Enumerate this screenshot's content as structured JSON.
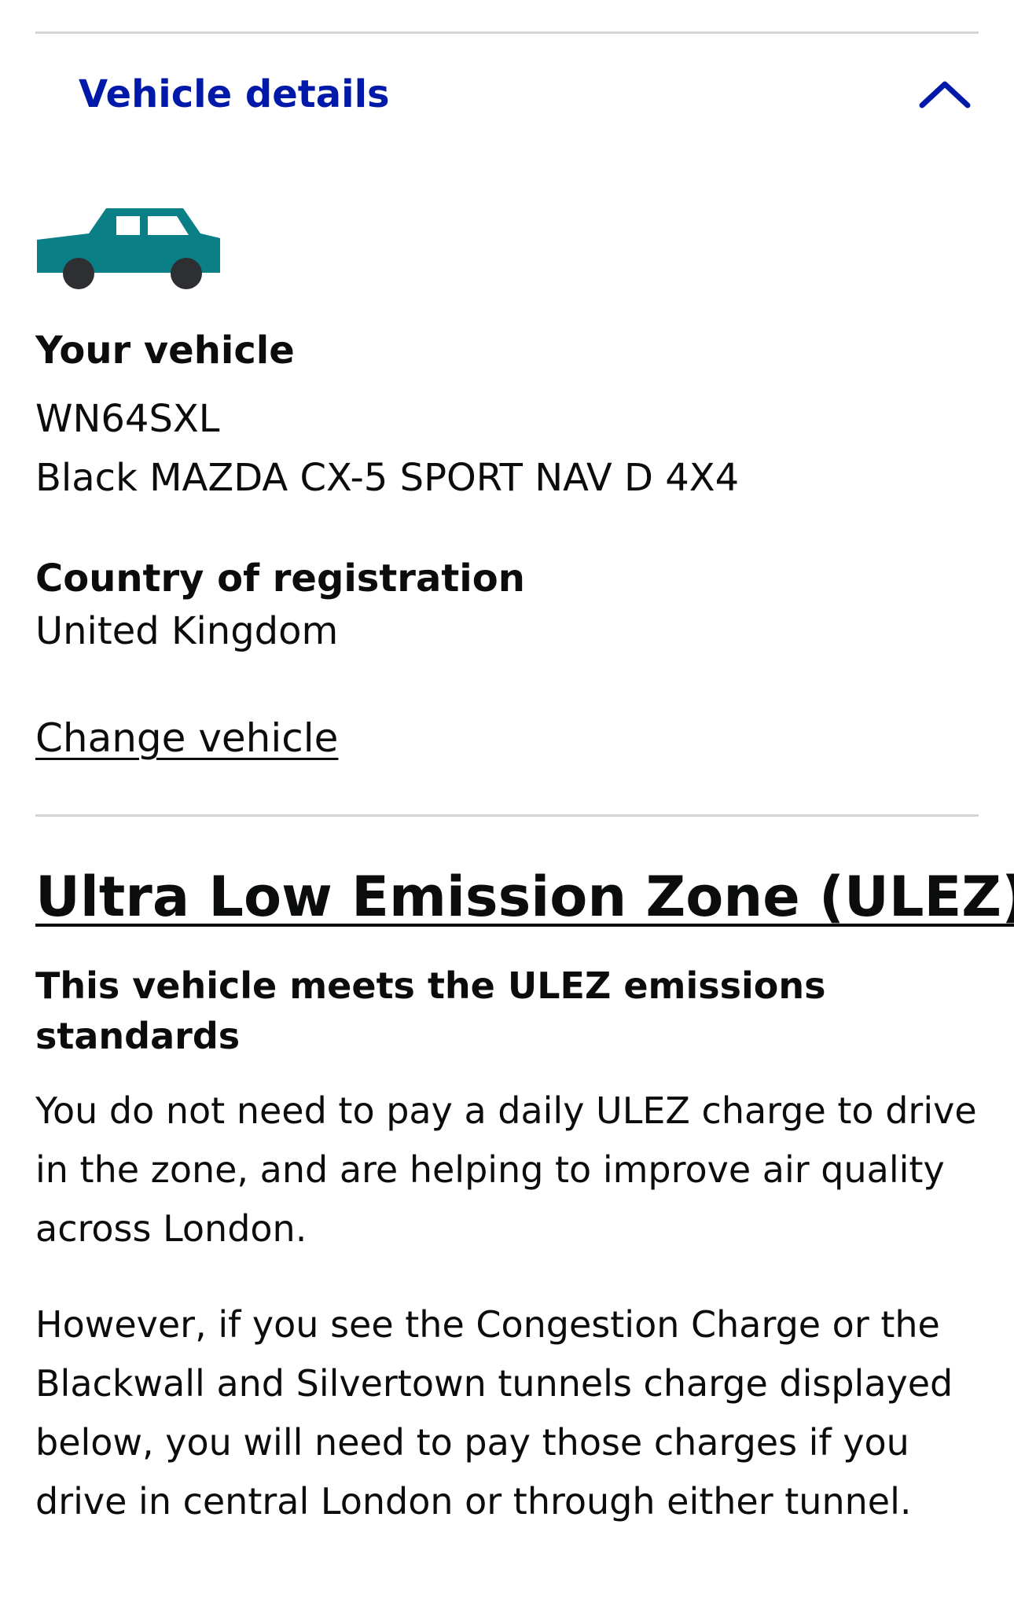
{
  "accordion": {
    "title": "Vehicle details",
    "chevron_icon": "chevron-up-icon",
    "title_color": "#0019a8"
  },
  "vehicle": {
    "icon": "car-icon",
    "icon_color": "#0a7f86",
    "your_vehicle_label": "Your vehicle",
    "registration": "WN64SXL",
    "description": "Black MAZDA CX-5 SPORT NAV D 4X4",
    "country_label": "Country of registration",
    "country_value": "United Kingdom",
    "change_link": "Change vehicle"
  },
  "ulez": {
    "heading": "Ultra Low Emission Zone (ULEZ)",
    "status": "This vehicle meets the ULEZ emissions standards",
    "paragraph_1": "You do not need to pay a daily ULEZ charge to drive in the zone, and are helping to improve air quality across London.",
    "paragraph_2": "However, if you see the Congestion Charge or the Blackwall and Silvertown tunnels charge displayed below, you will need to pay those charges if you drive in central London or through either tunnel."
  }
}
